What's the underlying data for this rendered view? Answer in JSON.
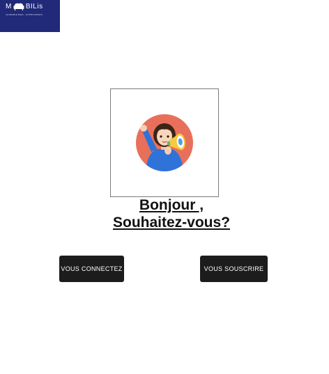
{
  "brand": {
    "name_prefix": "M",
    "name_suffix": "BILis",
    "tagline": "LE MEUBLE IDEAL · NOTRE MISSION",
    "logo_icon": "armchair-icon",
    "color": "#202a78"
  },
  "avatar": {
    "icon": "person-megaphone-icon",
    "circle_color": "#e8705a"
  },
  "greeting": {
    "line1": "Bonjour ,",
    "line2": "Souhaitez-vous?"
  },
  "actions": {
    "login_label": "VOUS  CONNECTEZ",
    "signup_label": "VOUS  SOUSCRIRE",
    "button_color": "#1c1c1c"
  }
}
